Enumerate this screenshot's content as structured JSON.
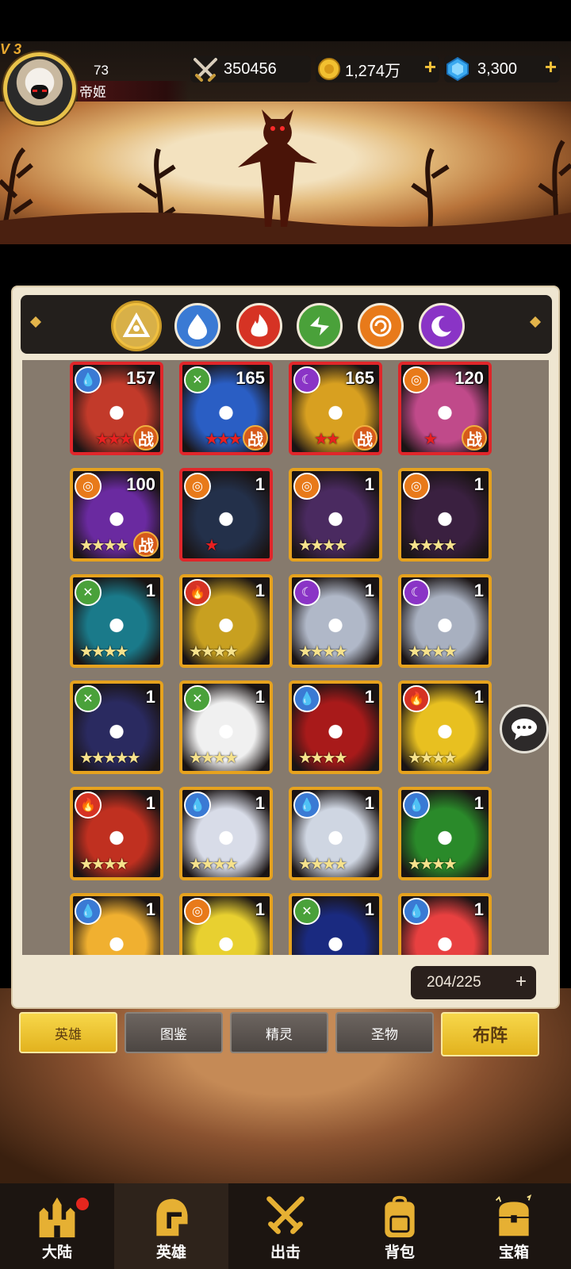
{
  "player": {
    "vip": "V 3",
    "level": "73",
    "name": "帝姬"
  },
  "resources": {
    "power": "350456",
    "gold": "1,274万",
    "gems": "3,300",
    "plus": "+"
  },
  "element_filters": [
    {
      "name": "all",
      "icon": "triangle-all-icon",
      "active": true
    },
    {
      "name": "water",
      "icon": "water-drop-icon",
      "active": false
    },
    {
      "name": "fire",
      "icon": "fire-icon",
      "active": false
    },
    {
      "name": "wind",
      "icon": "wind-icon",
      "active": false
    },
    {
      "name": "sun",
      "icon": "sun-spiral-icon",
      "active": false
    },
    {
      "name": "moon",
      "icon": "moon-icon",
      "active": false
    }
  ],
  "heroes": [
    {
      "level": "157",
      "element": "water",
      "stars": "★★★",
      "star_color": "red",
      "in_battle": true,
      "frame": "red"
    },
    {
      "level": "165",
      "element": "wind",
      "stars": "★★★",
      "star_color": "red",
      "in_battle": true,
      "frame": "red"
    },
    {
      "level": "165",
      "element": "moon",
      "stars": "★★",
      "star_color": "red",
      "in_battle": true,
      "frame": "red"
    },
    {
      "level": "120",
      "element": "sun",
      "stars": "★",
      "star_color": "red",
      "in_battle": true,
      "frame": "red"
    },
    {
      "level": "100",
      "element": "sun",
      "stars": "★★★★",
      "star_color": "yellow",
      "in_battle": true,
      "frame": "gold"
    },
    {
      "level": "1",
      "element": "sun",
      "stars": "★",
      "star_color": "red",
      "in_battle": false,
      "frame": "red"
    },
    {
      "level": "1",
      "element": "sun",
      "stars": "★★★★",
      "star_color": "yellow",
      "in_battle": false,
      "frame": "gold"
    },
    {
      "level": "1",
      "element": "sun",
      "stars": "★★★★",
      "star_color": "yellow",
      "in_battle": false,
      "frame": "gold"
    },
    {
      "level": "1",
      "element": "wind",
      "stars": "★★★★",
      "star_color": "yellow",
      "in_battle": false,
      "frame": "gold"
    },
    {
      "level": "1",
      "element": "fire",
      "stars": "★★★★",
      "star_color": "yellow",
      "in_battle": false,
      "frame": "gold"
    },
    {
      "level": "1",
      "element": "moon",
      "stars": "★★★★",
      "star_color": "yellow",
      "in_battle": false,
      "frame": "gold"
    },
    {
      "level": "1",
      "element": "moon",
      "stars": "★★★★",
      "star_color": "yellow",
      "in_battle": false,
      "frame": "gold"
    },
    {
      "level": "1",
      "element": "wind",
      "stars": "★★★★★",
      "star_color": "yellow",
      "in_battle": false,
      "frame": "gold"
    },
    {
      "level": "1",
      "element": "wind",
      "stars": "★★★★",
      "star_color": "yellow",
      "in_battle": false,
      "frame": "gold"
    },
    {
      "level": "1",
      "element": "water",
      "stars": "★★★★",
      "star_color": "yellow",
      "in_battle": false,
      "frame": "gold"
    },
    {
      "level": "1",
      "element": "fire",
      "stars": "★★★★",
      "star_color": "yellow",
      "in_battle": false,
      "frame": "gold"
    },
    {
      "level": "1",
      "element": "fire",
      "stars": "★★★★",
      "star_color": "yellow",
      "in_battle": false,
      "frame": "gold"
    },
    {
      "level": "1",
      "element": "water",
      "stars": "★★★★",
      "star_color": "yellow",
      "in_battle": false,
      "frame": "gold"
    },
    {
      "level": "1",
      "element": "water",
      "stars": "★★★★",
      "star_color": "yellow",
      "in_battle": false,
      "frame": "gold"
    },
    {
      "level": "1",
      "element": "water",
      "stars": "★★★★",
      "star_color": "yellow",
      "in_battle": false,
      "frame": "gold"
    },
    {
      "level": "1",
      "element": "water",
      "stars": "",
      "star_color": "yellow",
      "in_battle": false,
      "frame": "gold"
    },
    {
      "level": "1",
      "element": "sun",
      "stars": "",
      "star_color": "yellow",
      "in_battle": false,
      "frame": "gold"
    },
    {
      "level": "1",
      "element": "wind",
      "stars": "",
      "star_color": "yellow",
      "in_battle": false,
      "frame": "gold"
    },
    {
      "level": "1",
      "element": "water",
      "stars": "",
      "star_color": "yellow",
      "in_battle": false,
      "frame": "gold"
    }
  ],
  "battle_label": "战",
  "capacity": "204/225",
  "capacity_plus": "+",
  "tabs": {
    "heroes": "英雄",
    "codex": "图鉴",
    "spirits": "精灵",
    "relics": "圣物",
    "formation": "布阵"
  },
  "nav": {
    "continent": "大陆",
    "heroes": "英雄",
    "battle": "出击",
    "bag": "背包",
    "chest": "宝箱"
  },
  "colors": {
    "gold_accent": "#f3c23a",
    "red_frame": "#e0262a",
    "gold_frame": "#e6a21e",
    "panel": "#efe6d1",
    "grid_bg": "#867a6d"
  }
}
